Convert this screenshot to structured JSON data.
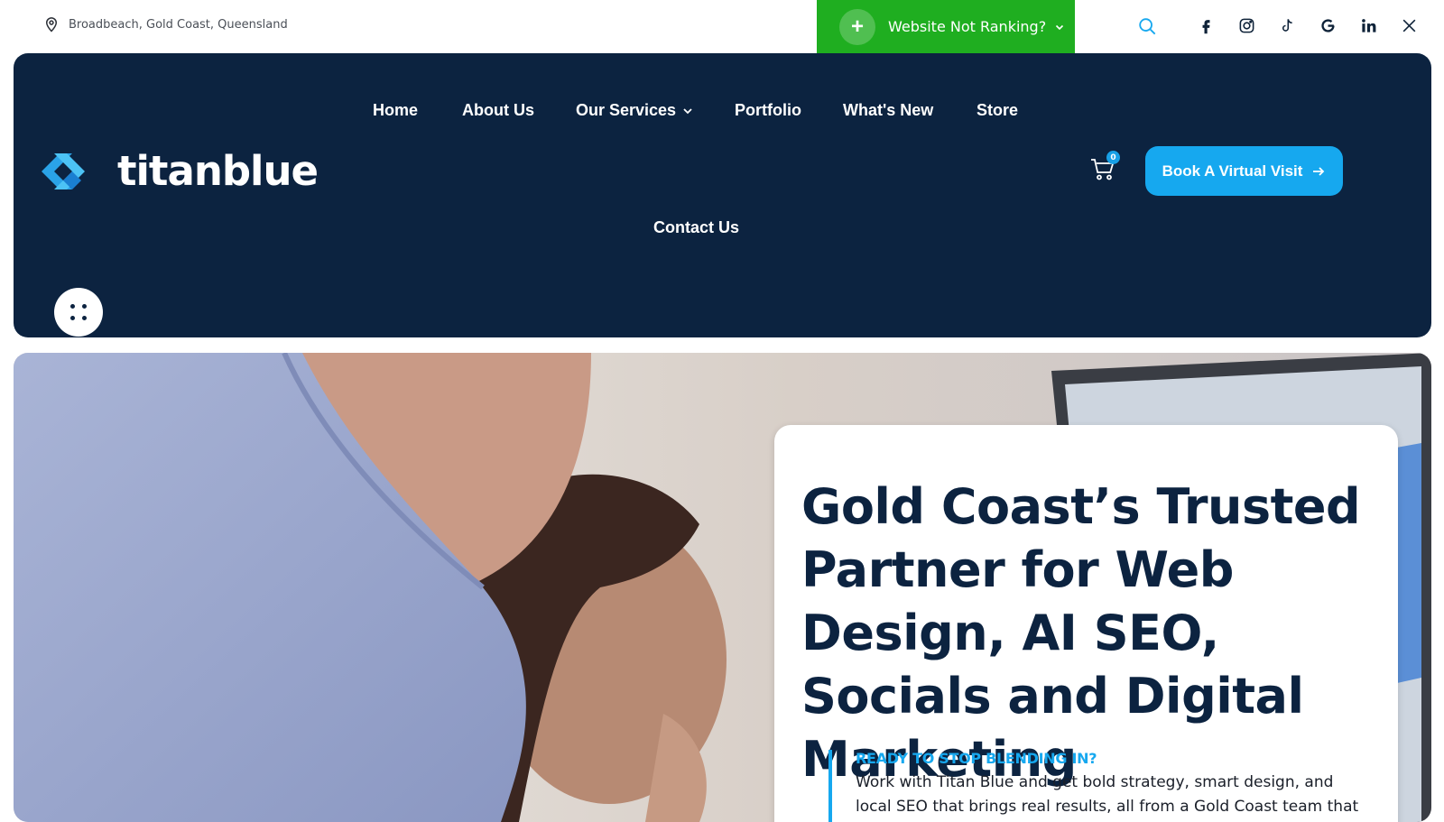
{
  "topbar": {
    "location": "Broadbeach, Gold Coast, Queensland",
    "promo_label": "Website Not Ranking?",
    "promo_plus": "+",
    "socials": [
      "facebook-icon",
      "instagram-icon",
      "tiktok-icon",
      "google-icon",
      "linkedin-icon",
      "x-icon"
    ]
  },
  "brand": {
    "name": "titanblue"
  },
  "nav": {
    "items": [
      "Home",
      "About Us",
      "Our Services",
      "Portfolio",
      "What's New",
      "Store",
      "Contact Us"
    ]
  },
  "cart": {
    "count": "0"
  },
  "cta": {
    "label": "Book A Virtual Visit"
  },
  "hero": {
    "heading": "Gold Coast’s Trusted Partner for Web Design, AI SEO, Socials and Digital Marketing",
    "kicker": "READY TO STOP BLENDING IN?",
    "body": "Work with Titan Blue and get bold strategy, smart design, and local SEO that brings real results, all from a Gold Coast team that gets it."
  },
  "colors": {
    "navy": "#0c2340",
    "accent_blue": "#16a8ef",
    "promo_green": "#1fae20"
  }
}
